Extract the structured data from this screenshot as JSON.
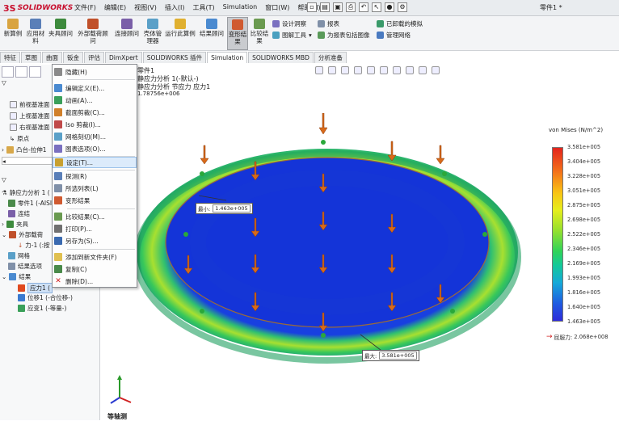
{
  "app": {
    "logo_ds": "3S",
    "logo_text": "SOLIDWORKS",
    "doc_title": "零件1 *"
  },
  "menu": [
    "文件(F)",
    "编辑(E)",
    "视图(V)",
    "插入(I)",
    "工具(T)",
    "Simulation",
    "窗口(W)",
    "帮助(H)"
  ],
  "ribbon": {
    "new_study": "新算例",
    "apply_material": "应用材料",
    "fixtures": "夹具顾问",
    "external_loads": "外部载荷顾问",
    "connections": "连接顾问",
    "shell_manager": "壳体管理器",
    "run": "运行此算例",
    "results_advisor": "结果顾问",
    "deform_result": "变形结果",
    "compare_results": "比较结果",
    "design_insight": "设计洞察",
    "plot_tools": "图解工具",
    "report": "报表",
    "include_image": "为报表包括图像",
    "offloaded_sim": "已卸载的模拟",
    "manage_network": "管理网络"
  },
  "tabs": [
    "特征",
    "草图",
    "曲面",
    "钣金",
    "评估",
    "DimXpert",
    "SOLIDWORKS 插件",
    "Simulation",
    "SOLIDWORKS MBD",
    "分析准备"
  ],
  "active_tab": "Simulation",
  "tree": {
    "front_plane": "前视基准面",
    "top_plane": "上视基准面",
    "right_plane": "右视基准面",
    "origin": "原点",
    "boss_extrude": "凸台-拉伸1",
    "study": "静应力分析 1 (",
    "part": "零件1 (-AISI",
    "connections": "连结",
    "fixtures": "夹具",
    "external_loads": "外部载荷",
    "force": "力-1 (:按",
    "mesh": "网格",
    "result_options": "结果选项",
    "results": "结果",
    "stress": "应力1 (",
    "displacement": "位移1 (-合位移-)",
    "strain": "应变1 (-等量-)"
  },
  "context_menu": [
    {
      "label": "隐藏(H)",
      "icon": "hide-icon"
    },
    {
      "label": "编辑定义(E)...",
      "icon": "edit-definition-icon"
    },
    {
      "label": "动画(A)...",
      "icon": "animate-icon"
    },
    {
      "label": "截面剪裁(C)...",
      "icon": "section-clip-icon"
    },
    {
      "label": "Iso 剪裁(I)...",
      "icon": "iso-clip-icon"
    },
    {
      "label": "网格刻切(M)...",
      "icon": "mesh-probe-icon"
    },
    {
      "label": "图表选项(O)...",
      "icon": "chart-options-icon"
    },
    {
      "label": "设定(T)...",
      "icon": "settings-icon"
    },
    {
      "label": "探测(R)",
      "icon": "probe-icon"
    },
    {
      "label": "所选列表(L)",
      "icon": "list-selected-icon"
    },
    {
      "label": "变形结果",
      "icon": "deformed-result-icon"
    },
    {
      "label": "比较结果(C)...",
      "icon": "compare-results-icon"
    },
    {
      "label": "打印(P)...",
      "icon": "print-icon"
    },
    {
      "label": "另存为(S)...",
      "icon": "save-as-icon"
    },
    {
      "label": "添加到新文件夹(F)",
      "icon": "add-folder-icon"
    },
    {
      "label": "复制(C)",
      "icon": "copy-icon"
    },
    {
      "label": "删除(D)...",
      "icon": "delete-icon"
    }
  ],
  "viewport": {
    "line1": "零件1",
    "line2": "静应力分析 1(-默认-)",
    "line3": "静应力分析 节应力 应力1",
    "line4": "1.78756e+006",
    "min_label": "最小:",
    "min_value": "1.463e+005",
    "max_label": "最大:",
    "max_value": "3.581e+005",
    "legend_title": "von Mises (N/m^2)",
    "legend_values": [
      "3.581e+005",
      "3.404e+005",
      "3.228e+005",
      "3.051e+005",
      "2.875e+005",
      "2.698e+005",
      "2.522e+005",
      "2.346e+005",
      "2.169e+005",
      "1.993e+005",
      "1.816e+005",
      "1.640e+005",
      "1.463e+005"
    ],
    "yield_label": "屈服力:",
    "yield_value": "2.068e+008",
    "bottom_label": "等轴测"
  },
  "colors": {
    "accent": "#c8102e",
    "selection": "#cfe1f6",
    "fea_blue": "#1434d8",
    "fea_green": "#32c85a"
  }
}
